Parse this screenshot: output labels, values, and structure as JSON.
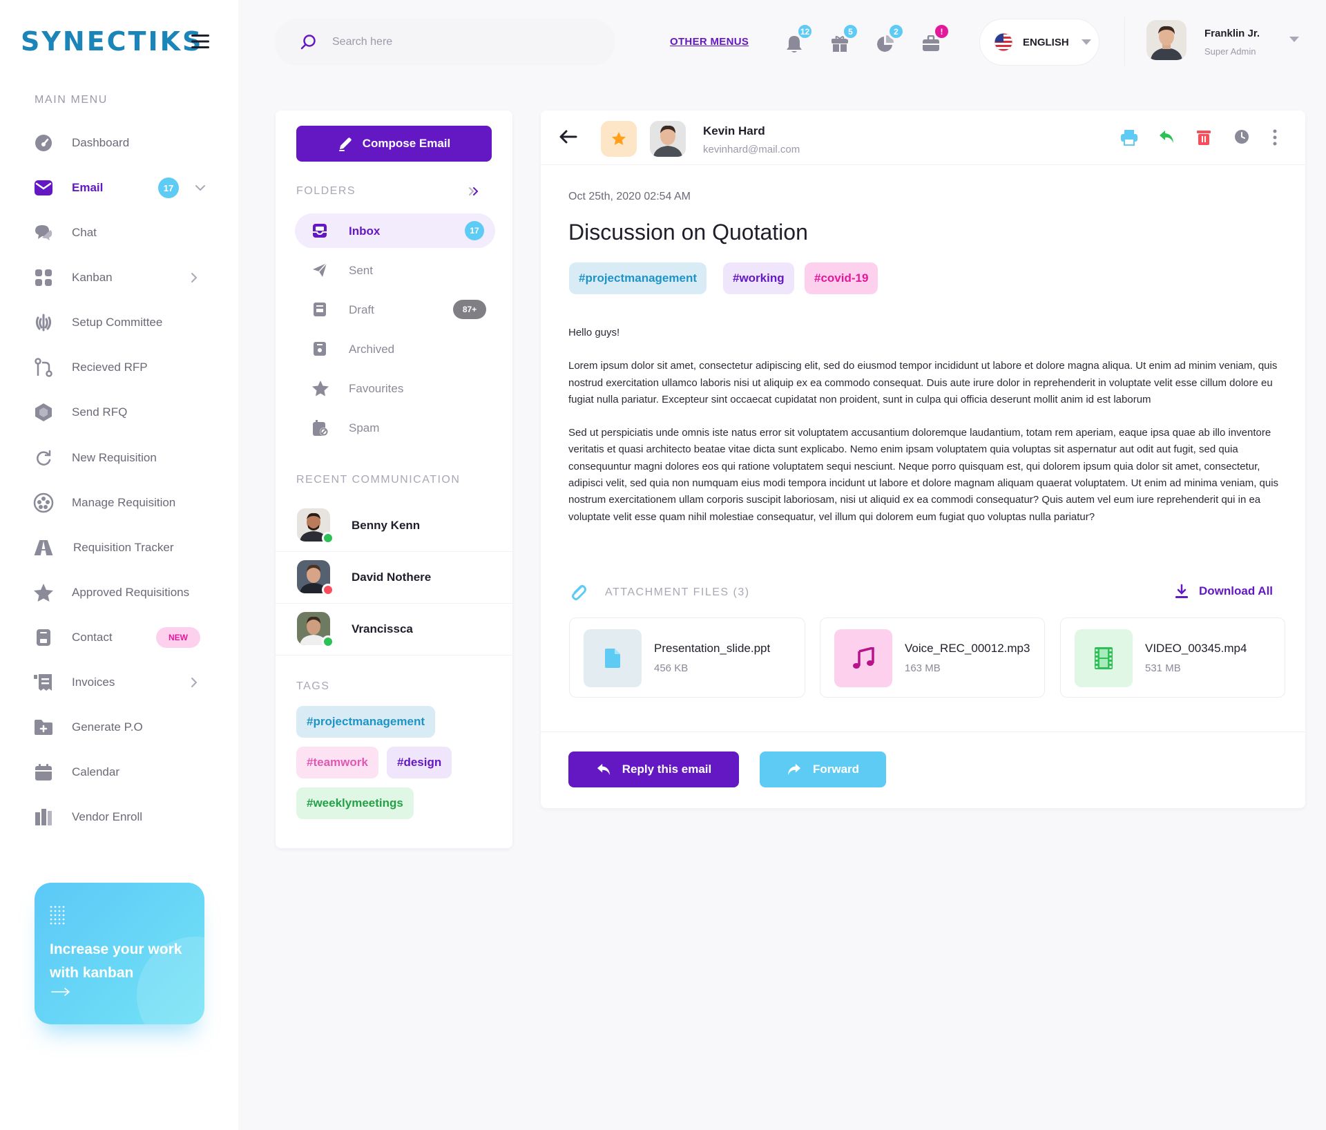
{
  "brand": {
    "name": "SYNECTIKS"
  },
  "sidebar": {
    "menu_title": "MAIN MENU",
    "items": [
      {
        "label": "Dashboard",
        "icon": "speedometer-icon"
      },
      {
        "label": "Email",
        "icon": "envelope-icon",
        "active": true,
        "count": "17"
      },
      {
        "label": "Chat",
        "icon": "chat-icon"
      },
      {
        "label": "Kanban",
        "icon": "grid-icon"
      },
      {
        "label": "Setup Committee",
        "icon": "emblem-icon"
      },
      {
        "label": "Recieved RFP",
        "icon": "flow-icon"
      },
      {
        "label": "Send RFQ",
        "icon": "hexagon-icon"
      },
      {
        "label": "New Requisition",
        "icon": "refresh-icon"
      },
      {
        "label": "Manage Requisition",
        "icon": "aperture-icon"
      },
      {
        "label": "Requisition Tracker",
        "icon": "tracker-icon"
      },
      {
        "label": "Approved Requisitions",
        "icon": "star-icon"
      },
      {
        "label": "Contact",
        "icon": "contact-icon",
        "badge": "NEW"
      },
      {
        "label": "Invoices",
        "icon": "invoice-icon"
      },
      {
        "label": "Generate P.O",
        "icon": "folder-plus-icon"
      },
      {
        "label": "Calendar",
        "icon": "calendar-icon"
      },
      {
        "label": "Vendor Enroll",
        "icon": "enroll-icon"
      }
    ],
    "promo": {
      "text": "Increase your work with kanban",
      "arrow": "→"
    }
  },
  "header": {
    "search_placeholder": "Search here",
    "other_menus": "OTHER MENUS",
    "notifications": [
      {
        "icon": "bell-icon",
        "count": "12",
        "color": "#5ecbf5"
      },
      {
        "icon": "gift-icon",
        "count": "5",
        "color": "#5ecbf5"
      },
      {
        "icon": "pie-chart-icon",
        "count": "2",
        "color": "#5ecbf5"
      },
      {
        "icon": "briefcase-icon",
        "count": "!",
        "color": "#e4189b"
      }
    ],
    "language": "ENGLISH",
    "user": {
      "name": "Franklin Jr.",
      "role": "Super Admin"
    }
  },
  "folders": {
    "compose_label": "Compose Email",
    "folders_title": "FOLDERS",
    "items": [
      {
        "label": "Inbox",
        "icon": "inbox-icon",
        "active": true,
        "count": "17"
      },
      {
        "label": "Sent",
        "icon": "send-icon"
      },
      {
        "label": "Draft",
        "icon": "draft-icon",
        "badge": "87+"
      },
      {
        "label": "Archived",
        "icon": "archive-icon"
      },
      {
        "label": "Favourites",
        "icon": "star-icon"
      },
      {
        "label": "Spam",
        "icon": "spam-icon"
      }
    ],
    "recent_title": "RECENT COMMUNICATION",
    "contacts": [
      {
        "name": "Benny Kenn",
        "status_color": "#2bc155"
      },
      {
        "name": "David Nothere",
        "status_color": "#f94d5b"
      },
      {
        "name": "Vrancissca",
        "status_color": "#2bc155"
      }
    ],
    "tags_title": "TAGS",
    "tags": [
      {
        "label": "#projectmanagement",
        "bg": "#d9ecf5",
        "fg": "#1e93c6"
      },
      {
        "label": "#teamwork",
        "bg": "#fde2f3",
        "fg": "#e058b4"
      },
      {
        "label": "#design",
        "bg": "#efe6fb",
        "fg": "#6418c3"
      },
      {
        "label": "#weeklymeetings",
        "bg": "#e0f7e6",
        "fg": "#24a046"
      }
    ]
  },
  "email": {
    "sender_name": "Kevin Hard",
    "sender_email": "kevinhard@mail.com",
    "actions": [
      "print-icon",
      "reply-icon",
      "trash-icon",
      "clock-icon",
      "more-vertical-icon"
    ],
    "date": "Oct 25th, 2020  02:54 AM",
    "subject": "Discussion on Quotation",
    "tags": [
      {
        "label": "#projectmanagement",
        "bg": "#d9ecf5",
        "fg": "#1e93c6"
      },
      {
        "label": "#working",
        "bg": "#efe6fb",
        "fg": "#6418c3"
      },
      {
        "label": "#covid-19",
        "bg": "#fdd1ee",
        "fg": "#e4189b"
      }
    ],
    "greeting": "Hello guys!",
    "paragraph1": "Lorem ipsum dolor sit amet, consectetur adipiscing elit, sed do eiusmod tempor incididunt ut labore et dolore magna aliqua. Ut enim ad minim veniam, quis nostrud exercitation ullamco laboris nisi ut aliquip ex ea commodo consequat. Duis aute irure dolor in reprehenderit in voluptate velit esse cillum dolore eu fugiat nulla pariatur. Excepteur sint occaecat cupidatat non proident, sunt in culpa qui officia deserunt mollit anim id est laborum",
    "paragraph2": "Sed ut perspiciatis unde omnis iste natus error sit voluptatem accusantium doloremque laudantium, totam rem aperiam, eaque ipsa quae ab illo inventore veritatis et quasi architecto beatae vitae dicta sunt explicabo. Nemo enim ipsam voluptatem quia voluptas sit aspernatur aut odit aut fugit, sed quia consequuntur magni dolores eos qui ratione voluptatem sequi nesciunt. Neque porro quisquam est, qui dolorem ipsum quia dolor sit amet, consectetur, adipisci velit, sed quia non numquam eius modi tempora incidunt ut labore et dolore magnam aliquam quaerat voluptatem. Ut enim ad minima veniam, quis nostrum exercitationem ullam corporis suscipit laboriosam, nisi ut aliquid ex ea commodi consequatur? Quis autem vel eum iure reprehenderit qui in ea voluptate velit esse quam nihil molestiae consequatur, vel illum qui dolorem eum fugiat quo voluptas nulla pariatur?",
    "attachments_title": "ATTACHMENT FILES (3)",
    "download_all": "Download All",
    "files": [
      {
        "name": "Presentation_slide.ppt",
        "size": "456 KB",
        "icon": "document-icon"
      },
      {
        "name": "Voice_REC_00012.mp3",
        "size": "163 MB",
        "icon": "music-note-icon"
      },
      {
        "name": "VIDEO_00345.mp4",
        "size": "531 MB",
        "icon": "film-icon"
      }
    ],
    "reply_label": "Reply this email",
    "forward_label": "Forward"
  }
}
